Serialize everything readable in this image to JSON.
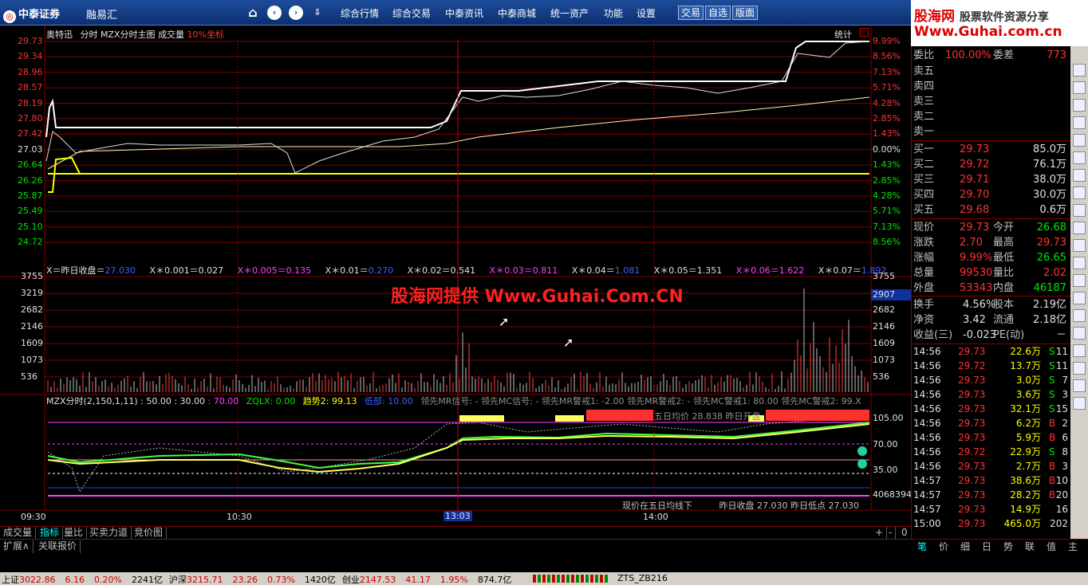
{
  "topbar": {
    "brand": "中泰证券",
    "app_name": "融易汇",
    "menus": [
      "综合行情",
      "综合交易",
      "中泰资讯",
      "中泰商城",
      "统一资产",
      "功能",
      "设置"
    ],
    "small_buttons": [
      "交易",
      "自选",
      "版面"
    ]
  },
  "ad": {
    "line1_a": "股海网",
    "line1_b": "股票软件资源分享",
    "line2": "Www.Guhai.com.cn"
  },
  "watermark": "股海网提供 Www.Guhai.Com.CN",
  "chart_header": {
    "stock": "奥特迅",
    "mode": "分时",
    "main": "MZX分时主图",
    "vol": "成交量",
    "coord": "10%坐标",
    "stats": "统计"
  },
  "price_axis": [
    "29.73",
    "29.34",
    "28.96",
    "28.57",
    "28.19",
    "27.80",
    "27.42",
    "27.03",
    "26.64",
    "26.26",
    "25.87",
    "25.49",
    "25.10",
    "24.72"
  ],
  "pct_axis": [
    "9.99%",
    "8.56%",
    "7.13%",
    "5.71%",
    "4.28%",
    "2.85%",
    "1.43%",
    "0.00%",
    "1.43%",
    "2.85%",
    "4.28%",
    "5.71%",
    "7.13%",
    "8.56%"
  ],
  "formula_row": [
    {
      "k": "X＝昨日收盘＝",
      "v": "27.030"
    },
    {
      "k": "X＊0.001＝",
      "v": "0.027"
    },
    {
      "k": "X＊0.005＝",
      "v": "0.135"
    },
    {
      "k": "X＊0.01＝",
      "v": "0.270"
    },
    {
      "k": "X＊0.02＝",
      "v": "0.541"
    },
    {
      "k": "X＊0.03＝",
      "v": "0.811"
    },
    {
      "k": "X＊0.04＝",
      "v": "1.081"
    },
    {
      "k": "X＊0.05＝",
      "v": "1.351"
    },
    {
      "k": "X＊0.06＝",
      "v": "1.622"
    },
    {
      "k": "X＊0.07＝",
      "v": "1.892"
    }
  ],
  "vol_axis": [
    "3755",
    "3219",
    "2682",
    "2146",
    "1609",
    "1073",
    "536"
  ],
  "vol_axis_right": [
    "3755",
    "2907",
    "2682",
    "2146",
    "1609",
    "1073",
    "536"
  ],
  "vol_current": "2907",
  "indicator_header": {
    "name": "MZX分时(2,150,1,11)",
    "vals": [
      " : 50.00",
      " : 30.00",
      " : 70.00"
    ],
    "zqlx": "ZQLX: 0.00",
    "trend": "趋势2: 99.13",
    "low": "低部: 10.00",
    "signals": "领先MR信号: - 领先MC信号: - 领先MR警戒1: -2.00 领先MR警戒2: - 领先MC警戒1: 80.00 领先MC警戒2: 99.X"
  },
  "ind_overlay": "五日均价 28.838  昨日开盘",
  "ind_axis": [
    "105.00",
    "70.00",
    "35.00",
    "4068394"
  ],
  "ind_footer": {
    "left": "现价在五日均线下",
    "mid": "昨日收盘",
    "mid_v": "27.030",
    "right": "昨日低点",
    "right_v": "27.030"
  },
  "time_axis": [
    "09:30",
    "10:30",
    "13:03",
    "14:00"
  ],
  "tabs": [
    "成交量",
    "指标",
    "量比",
    "买卖力道",
    "竞价图"
  ],
  "tabs_right": [
    "+",
    "-",
    "0"
  ],
  "tabs2": [
    "扩展∧",
    "关联报价"
  ],
  "order_book": {
    "wei_bi_label": "委比",
    "wei_bi": "100.00%",
    "wei_cha_label": "委差",
    "wei_cha": "773",
    "sells": [
      {
        "l": "卖五"
      },
      {
        "l": "卖四"
      },
      {
        "l": "卖三"
      },
      {
        "l": "卖二"
      },
      {
        "l": "卖一"
      }
    ],
    "buys": [
      {
        "l": "买一",
        "p": "29.73",
        "v": "85.0万"
      },
      {
        "l": "买二",
        "p": "29.72",
        "v": "76.1万"
      },
      {
        "l": "买三",
        "p": "29.71",
        "v": "38.0万"
      },
      {
        "l": "买四",
        "p": "29.70",
        "v": "30.0万"
      },
      {
        "l": "买五",
        "p": "29.68",
        "v": "0.6万"
      }
    ]
  },
  "quote": [
    {
      "l1": "现价",
      "v1": "29.73",
      "l2": "今开",
      "v2": "26.68"
    },
    {
      "l1": "涨跌",
      "v1": "2.70",
      "l2": "最高",
      "v2": "29.73"
    },
    {
      "l1": "涨幅",
      "v1": "9.99%",
      "l2": "最低",
      "v2": "26.65"
    },
    {
      "l1": "总量",
      "v1": "99530",
      "l2": "量比",
      "v2": "2.02"
    },
    {
      "l1": "外盘",
      "v1": "53343",
      "l2": "内盘",
      "v2": "46187"
    }
  ],
  "finance": [
    {
      "l1": "换手",
      "v1": "4.56%",
      "l2": "股本",
      "v2": "2.19亿"
    },
    {
      "l1": "净资",
      "v1": "3.42",
      "l2": "流通",
      "v2": "2.18亿"
    },
    {
      "l1": "收益(三)",
      "v1": "-0.023",
      "l2": "PE(动)",
      "v2": "－"
    }
  ],
  "ticks": [
    {
      "t": "14:56",
      "p": "29.73",
      "v": "22.6万",
      "s": "S",
      "n": "11"
    },
    {
      "t": "14:56",
      "p": "29.72",
      "v": "13.7万",
      "s": "S",
      "n": "11"
    },
    {
      "t": "14:56",
      "p": "29.73",
      "v": "3.0万",
      "s": "S",
      "n": "7"
    },
    {
      "t": "14:56",
      "p": "29.73",
      "v": "3.6万",
      "s": "S",
      "n": "3"
    },
    {
      "t": "14:56",
      "p": "29.73",
      "v": "32.1万",
      "s": "S",
      "n": "15"
    },
    {
      "t": "14:56",
      "p": "29.73",
      "v": "6.2万",
      "s": "B",
      "n": "2"
    },
    {
      "t": "14:56",
      "p": "29.73",
      "v": "5.9万",
      "s": "B",
      "n": "6"
    },
    {
      "t": "14:56",
      "p": "29.72",
      "v": "22.9万",
      "s": "S",
      "n": "8"
    },
    {
      "t": "14:56",
      "p": "29.73",
      "v": "2.7万",
      "s": "B",
      "n": "3"
    },
    {
      "t": "14:57",
      "p": "29.73",
      "v": "38.6万",
      "s": "B",
      "n": "10"
    },
    {
      "t": "14:57",
      "p": "29.73",
      "v": "28.2万",
      "s": "B",
      "n": "20"
    },
    {
      "t": "14:57",
      "p": "29.73",
      "v": "14.9万",
      "s": "",
      "n": "16"
    },
    {
      "t": "15:00",
      "p": "29.73",
      "v": "465.0万",
      "s": "",
      "n": "202"
    }
  ],
  "rtabs": [
    "笔",
    "价",
    "细",
    "日",
    "势",
    "联",
    "值",
    "主"
  ],
  "status": [
    {
      "l": "上证",
      "v": "3022.86",
      "c": "6.16",
      "p": "0.20%",
      "a": "2241亿"
    },
    {
      "l": "沪深",
      "v": "3215.71",
      "c": "23.26",
      "p": "0.73%",
      "a": "1420亿"
    },
    {
      "l": "创业",
      "v": "2147.53",
      "c": "41.17",
      "p": "1.95%",
      "a": "874.7亿"
    }
  ],
  "status_code": "ZTS_ZB216",
  "colors": {
    "up": "#ff3232",
    "down": "#00e600",
    "grid": "#800000",
    "bg": "#000000"
  }
}
